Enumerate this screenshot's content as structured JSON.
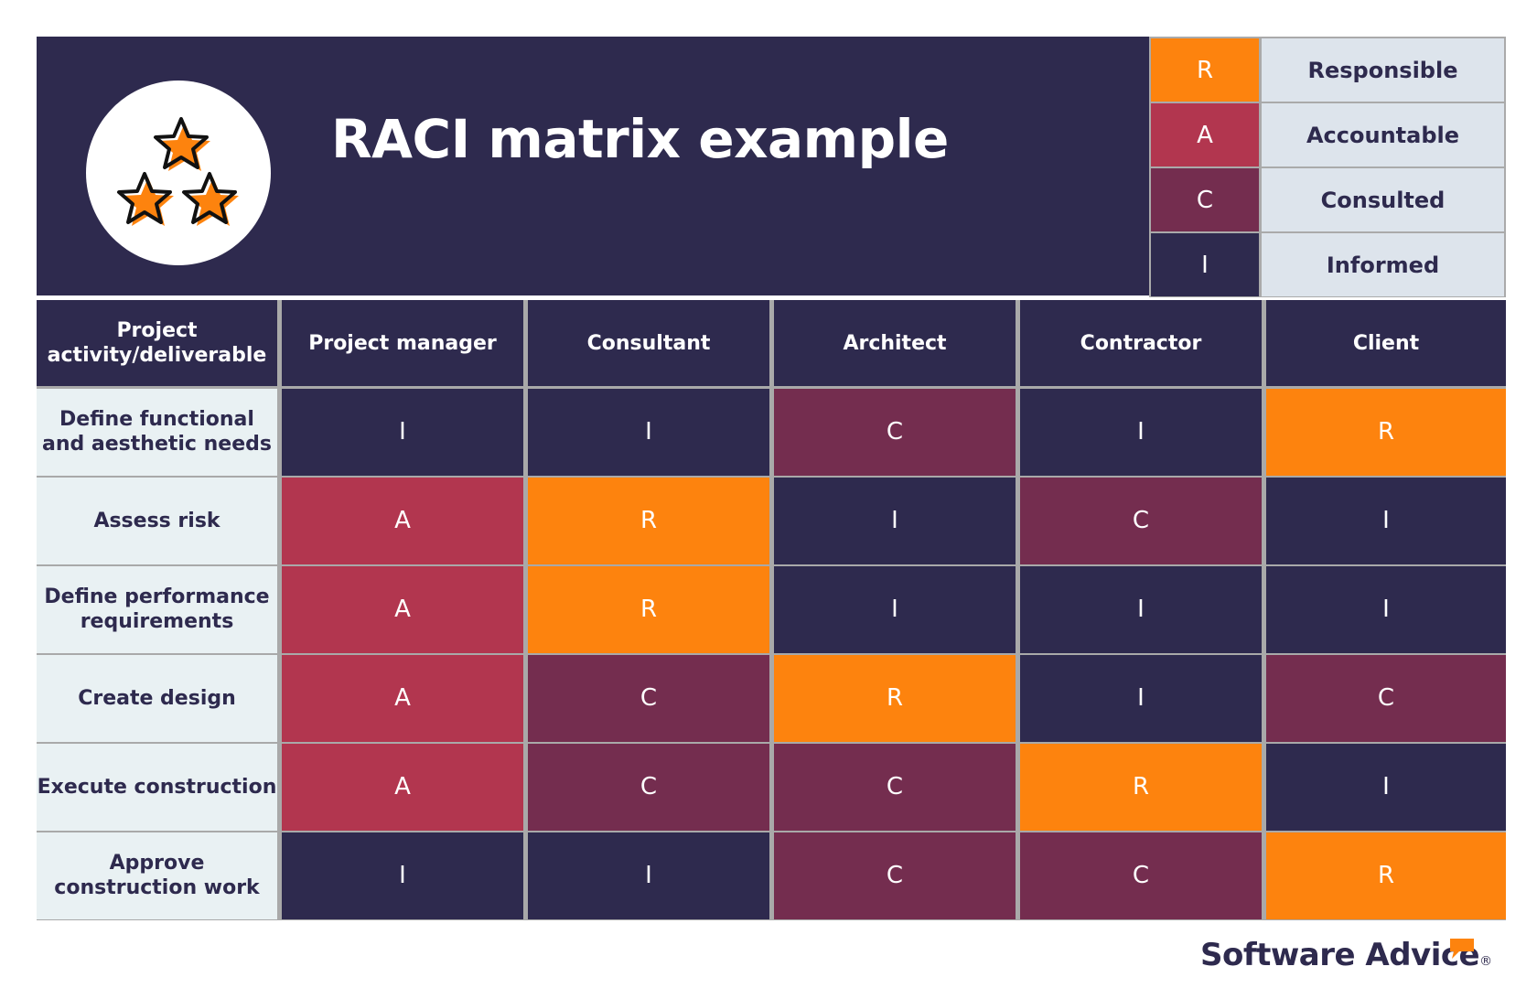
{
  "title": "RACI matrix example",
  "logo_icon": "three-stars-icon",
  "colors": {
    "navy": "#2e2a4e",
    "R": "#fd830e",
    "A": "#b2364f",
    "C": "#742d4f",
    "I": "#2e2a4e",
    "label_bg": "#dde4ec",
    "row_header_bg": "#e9f1f3"
  },
  "legend": [
    {
      "code": "R",
      "label": "Responsible"
    },
    {
      "code": "A",
      "label": "Accountable"
    },
    {
      "code": "C",
      "label": "Consulted"
    },
    {
      "code": "I",
      "label": "Informed"
    }
  ],
  "table": {
    "corner_header": "Project activity/deliverable",
    "columns": [
      "Project manager",
      "Consultant",
      "Architect",
      "Contractor",
      "Client"
    ],
    "rows": [
      {
        "activity": "Define functional and aesthetic needs",
        "values": [
          "I",
          "I",
          "C",
          "I",
          "R"
        ]
      },
      {
        "activity": "Assess risk",
        "values": [
          "A",
          "R",
          "I",
          "C",
          "I"
        ]
      },
      {
        "activity": "Define performance requirements",
        "values": [
          "A",
          "R",
          "I",
          "I",
          "I"
        ]
      },
      {
        "activity": "Create design",
        "values": [
          "A",
          "C",
          "R",
          "I",
          "C"
        ]
      },
      {
        "activity": "Execute construction",
        "values": [
          "A",
          "C",
          "C",
          "R",
          "I"
        ]
      },
      {
        "activity": "Approve construction work",
        "values": [
          "I",
          "I",
          "C",
          "C",
          "R"
        ]
      }
    ]
  },
  "brand": {
    "name": "Software Advice",
    "registered": "®",
    "icon": "speech-bubble-icon"
  }
}
